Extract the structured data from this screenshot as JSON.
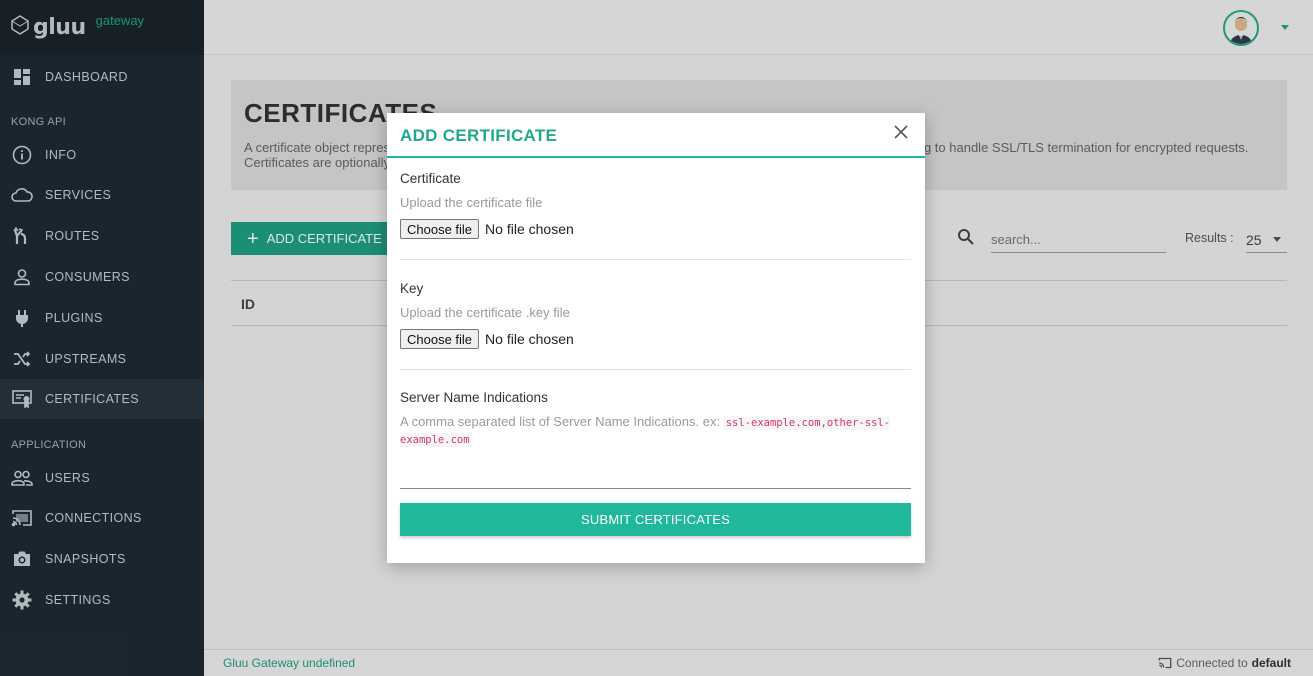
{
  "brand": {
    "logo_text": "gluu",
    "subtitle": "gateway"
  },
  "sidebar": {
    "items": [
      {
        "label": "DASHBOARD",
        "icon": "dashboard-icon"
      },
      {
        "label": "INFO",
        "icon": "info-icon"
      },
      {
        "label": "SERVICES",
        "icon": "cloud-icon"
      },
      {
        "label": "ROUTES",
        "icon": "routes-icon"
      },
      {
        "label": "CONSUMERS",
        "icon": "person-icon"
      },
      {
        "label": "PLUGINS",
        "icon": "plug-icon"
      },
      {
        "label": "UPSTREAMS",
        "icon": "shuffle-icon"
      },
      {
        "label": "CERTIFICATES",
        "icon": "certificate-icon",
        "active": true
      },
      {
        "label": "USERS",
        "icon": "people-icon"
      },
      {
        "label": "CONNECTIONS",
        "icon": "cast-icon"
      },
      {
        "label": "SNAPSHOTS",
        "icon": "camera-icon"
      },
      {
        "label": "SETTINGS",
        "icon": "gear-icon"
      }
    ],
    "sections": {
      "kong_api": "KONG API",
      "application": "APPLICATION"
    }
  },
  "page": {
    "title": "CERTIFICATES",
    "description": "A certificate object represents a public certificate/private key pair for an SSL certificate. These objects are used by Kong to handle SSL/TLS termination for encrypted requests. Certificates are optionally associated with SNI objects to tie a cert/key pair to one or more hostnames.",
    "add_button": "ADD CERTIFICATE",
    "search_placeholder": "search...",
    "results_label": "Results :",
    "results_value": "25",
    "table_headers": [
      "ID"
    ]
  },
  "modal": {
    "title": "ADD CERTIFICATE",
    "certificate": {
      "label": "Certificate",
      "hint": "Upload the certificate file",
      "button": "Choose file",
      "status": "No file chosen"
    },
    "key": {
      "label": "Key",
      "hint": "Upload the certificate .key file",
      "button": "Choose file",
      "status": "No file chosen"
    },
    "sni": {
      "label": "Server Name Indications",
      "hint": "A comma separated list of Server Name Indications. ex:",
      "example": "ssl-example.com,other-ssl-example.com"
    },
    "submit": "SUBMIT CERTIFICATES"
  },
  "footer": {
    "version": "Gluu Gateway undefined",
    "connected_prefix": "Connected to",
    "connected_name": "default"
  },
  "colors": {
    "accent": "#1fb89a",
    "sidebar": "#1e2a33"
  }
}
